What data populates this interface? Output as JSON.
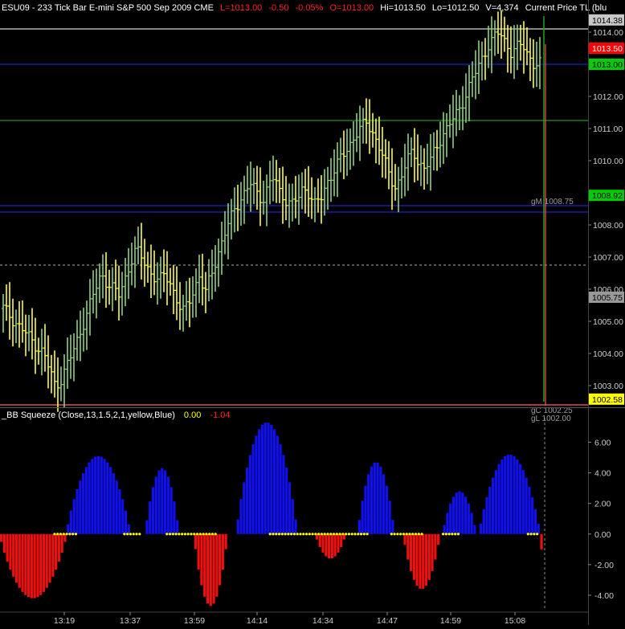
{
  "header": {
    "title_white": "ESU09 - 233 Tick Bar  E-mini S&P 500 Sep 2009  CME",
    "last": "L=1013.00",
    "chg": "-0.50",
    "chg_pct": "-0.05%",
    "open": "O=1013.00",
    "hi": "Hi=1013.50",
    "lo": "Lo=1012.50",
    "vol": "V=4,374",
    "current_price": "Current Price TL (blu"
  },
  "indicator_header": {
    "label": "_BB Squeeze (Close,13,1.5,2,1,yellow,Blue)",
    "v1": "0.00",
    "v2": "-1.04"
  },
  "colors": {
    "bar_yellow": "#ffff33",
    "bar_green": "#8fd07a",
    "hist_blue": "#1010ee",
    "hist_red": "#ee1010",
    "dot_yellow": "#ffff00",
    "line_blue": "#2020c8",
    "line_green": "#1f9a1f",
    "line_white": "#d8d8c0",
    "line_red": "#ff6060"
  },
  "chart_data": [
    {
      "type": "ohlc",
      "price_range": [
        1002.5,
        1014.5
      ],
      "y_ticks": [
        1003.0,
        1004.0,
        1005.0,
        1006.0,
        1007.0,
        1008.0,
        1009.0,
        1010.0,
        1011.0,
        1012.0,
        1013.0,
        1014.0
      ],
      "y_tick_labels": [
        "1003.00",
        "1004.00",
        "1005.00",
        "1006.00",
        "1007.00",
        "1008.00",
        "1009.00",
        "1010.00",
        "1011.00",
        "1012.00",
        "1013.00",
        "1014.00"
      ],
      "x_labels": [
        "13:19",
        "13:37",
        "13:59",
        "14:14",
        "14:34",
        "14:47",
        "14:59",
        "15:08"
      ],
      "bar_count": 168,
      "close_series": [
        1005.4,
        1005.2,
        1005.0,
        1004.8,
        1004.6,
        1004.4,
        1004.2,
        1004.0,
        1003.5,
        1003.0,
        1003.2,
        1003.6,
        1004.0,
        1004.5,
        1005.0,
        1005.5,
        1006.0,
        1006.5,
        1006.2,
        1006.0,
        1005.8,
        1006.3,
        1006.8,
        1007.2,
        1007.0,
        1006.7,
        1006.4,
        1006.2,
        1006.5,
        1006.2,
        1005.7,
        1005.2,
        1005.6,
        1006.0,
        1006.4,
        1005.8,
        1006.5,
        1007.0,
        1007.5,
        1008.0,
        1008.5,
        1008.8,
        1009.0,
        1009.3,
        1009.0,
        1008.8,
        1009.2,
        1009.5,
        1009.0,
        1008.8,
        1008.6,
        1008.8,
        1009.2,
        1009.0,
        1008.6,
        1008.8,
        1009.3,
        1009.6,
        1009.9,
        1010.2,
        1010.5,
        1010.8,
        1011.0,
        1011.2,
        1010.9,
        1010.5,
        1010.0,
        1009.5,
        1009.2,
        1009.5,
        1010.0,
        1010.3,
        1010.0,
        1009.7,
        1010.0,
        1010.4,
        1010.8,
        1011.0,
        1011.3,
        1011.6,
        1012.0,
        1012.4,
        1012.8,
        1013.2,
        1013.6,
        1013.8,
        1014.0,
        1013.7,
        1013.4,
        1013.5,
        1013.6,
        1013.3,
        1013.0,
        1013.0
      ],
      "open_price": 1013.0,
      "hi": 1013.5,
      "lo": 1012.5,
      "volume": "4,374",
      "right_labels": [
        {
          "text": "1014.38",
          "value": 1014.38,
          "bg": "#c8c8c8",
          "fg": "#000000"
        },
        {
          "text": "1013.50",
          "value": 1013.5,
          "bg": "#ff0000",
          "fg": "#ffffff"
        },
        {
          "text": "1013.00",
          "value": 1013.0,
          "bg": "#00cc00",
          "fg": "#000000"
        },
        {
          "text": "1008.92",
          "value": 1008.92,
          "bg": "#00cc00",
          "fg": "#000000"
        },
        {
          "text": "1005.75",
          "value": 1005.75,
          "bg": "#999999",
          "fg": "#000000"
        },
        {
          "text": "1002.58",
          "value": 1002.58,
          "bg": "#ffff00",
          "fg": "#000000"
        }
      ],
      "inline_labels": [
        {
          "text": "gM 1008.75",
          "value": 1008.75
        },
        {
          "text": "gC 1002.25",
          "value": 1002.25
        },
        {
          "text": "gL 1002.00",
          "value": 1002.0
        }
      ],
      "horizontal_lines": [
        {
          "value": 1014.1,
          "color": "white",
          "style": "solid"
        },
        {
          "value": 1013.0,
          "color": "blue",
          "style": "solid"
        },
        {
          "value": 1011.25,
          "color": "green",
          "style": "solid"
        },
        {
          "value": 1008.6,
          "color": "blue",
          "style": "solid"
        },
        {
          "value": 1008.4,
          "color": "blue",
          "style": "solid"
        },
        {
          "value": 1006.75,
          "color": "white",
          "style": "dashed"
        },
        {
          "value": 1002.4,
          "color": "red",
          "style": "solid"
        }
      ]
    },
    {
      "type": "histogram",
      "name": "_BB Squeeze (Close,13,1.5,2,1,yellow,Blue)",
      "y_range": [
        -5.0,
        7.5
      ],
      "y_ticks": [
        -4.0,
        -2.0,
        0.0,
        2.0,
        4.0,
        6.0
      ],
      "y_tick_labels": [
        "-4.00",
        "-2.00",
        "0.00",
        "2.00",
        "4.00",
        "6.00"
      ],
      "segments": [
        {
          "color": "red",
          "start": 0,
          "end": 22,
          "peak": -4.2
        },
        {
          "color": "blue",
          "start": 22,
          "end": 43,
          "peak": 5.1
        },
        {
          "color": "blue",
          "start": 48,
          "end": 59,
          "peak": 4.3
        },
        {
          "color": "red",
          "start": 64,
          "end": 75,
          "peak": -4.7
        },
        {
          "color": "blue",
          "start": 78,
          "end": 98,
          "peak": 7.3
        },
        {
          "color": "red",
          "start": 104,
          "end": 114,
          "peak": -1.6
        },
        {
          "color": "blue",
          "start": 118,
          "end": 130,
          "peak": 4.7
        },
        {
          "color": "red",
          "start": 133,
          "end": 145,
          "peak": -3.6
        },
        {
          "color": "blue",
          "start": 146,
          "end": 157,
          "peak": 2.8
        },
        {
          "color": "blue",
          "start": 158,
          "end": 178,
          "peak": 5.2
        },
        {
          "color": "red",
          "start": 178,
          "end": 179,
          "peak": -1.0
        }
      ]
    }
  ]
}
